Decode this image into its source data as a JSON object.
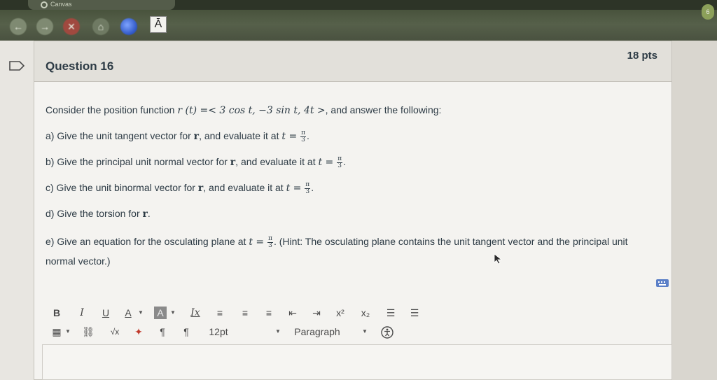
{
  "browser": {
    "tab_label": "Canvas",
    "font_button_label": "Ā"
  },
  "question": {
    "title": "Question 16",
    "points": "18 pts",
    "intro_prefix": "Consider the position function",
    "intro_math": "r (t) =< 3 cos t,  −3 sin t,  4t >",
    "intro_suffix": ", and answer the following:",
    "a_prefix": "a) Give the unit tangent vector for",
    "a_mid": ", and evaluate it at",
    "b_prefix": "b) Give the principal unit normal vector for",
    "b_mid": ", and evaluate it at",
    "c_prefix": "c) Give the unit binormal vector for",
    "c_mid": ", and evaluate it at",
    "d_prefix": "d) Give the torsion for",
    "e_prefix": "e) Give an equation for the osculating plane at",
    "e_hint": ". (Hint: The osculating plane contains the unit tangent vector and the principal unit normal vector.)",
    "r_symbol": "r",
    "t_eq": "t =",
    "frac_num": "π",
    "frac_den": "3"
  },
  "editor": {
    "bold": "B",
    "italic": "I",
    "underline": "U",
    "font_color": "A",
    "bg_color": "A",
    "clear_format": "Ix",
    "superscript": "x²",
    "subscript": "x₂",
    "font_size": "12pt",
    "paragraph": "Paragraph",
    "math": "√x"
  }
}
